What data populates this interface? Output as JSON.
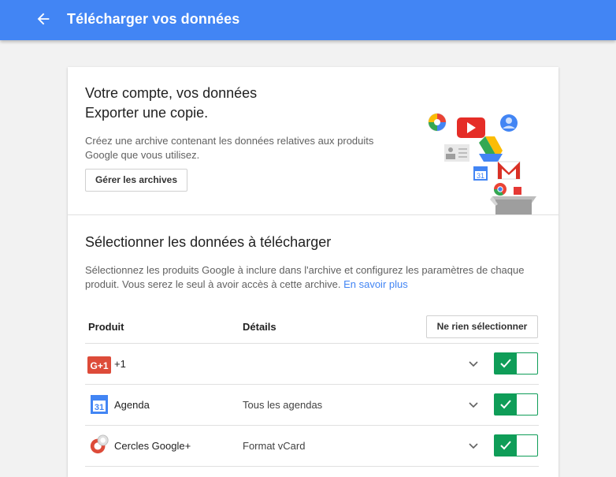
{
  "topbar": {
    "back_icon": "arrow-back-icon",
    "title": "Télécharger vos données",
    "color": "#4285f4"
  },
  "intro": {
    "title_line1": "Votre compte, vos données",
    "title_line2": "Exporter une copie.",
    "description": "Créez une archive contenant les données relatives aux produits Google que vous utilisez.",
    "manage_button": "Gérer les archives"
  },
  "select": {
    "title": "Sélectionner les données à télécharger",
    "description": "Sélectionnez les produits Google à inclure dans l'archive et configurez les paramètres de chaque produit. Vous serez le seul à avoir accès à cette archive.",
    "learn_more": "En savoir plus",
    "col_product": "Produit",
    "col_details": "Détails",
    "deselect_button": "Ne rien sélectionner"
  },
  "products": [
    {
      "name": "+1",
      "icon": "google-plus-one-icon",
      "details": "",
      "enabled": true
    },
    {
      "name": "Agenda",
      "icon": "calendar-icon",
      "details": "Tous les agendas",
      "enabled": true
    },
    {
      "name": "Cercles Google+",
      "icon": "circles-icon",
      "details": "Format vCard",
      "enabled": true
    }
  ],
  "colors": {
    "toggle_on": "#0f9d58",
    "link": "#4285f4"
  }
}
